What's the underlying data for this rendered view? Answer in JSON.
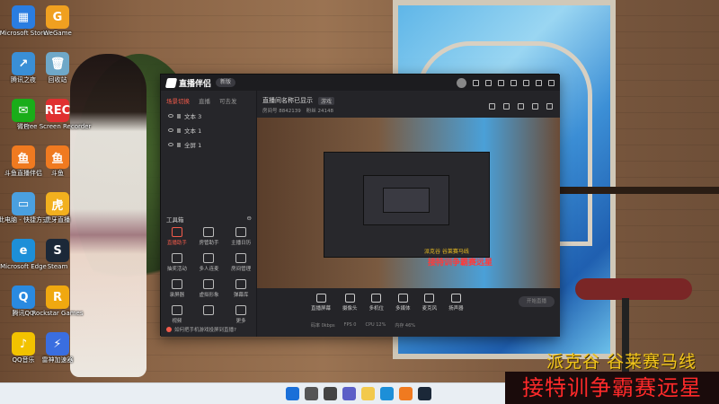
{
  "desktop": {
    "icons": [
      {
        "label": "Microsoft Store",
        "color": "#2a7de1",
        "glyph": "▦",
        "icon": "store-icon"
      },
      {
        "label": "WeGame",
        "color": "#f0a020",
        "glyph": "G",
        "icon": "wegame-icon"
      },
      {
        "label": "腾讯之夜",
        "color": "#3a8fd6",
        "glyph": "↗",
        "icon": "shortcut-icon"
      },
      {
        "label": "回收站",
        "color": "#6fa8c8",
        "glyph": "🗑",
        "icon": "recycle-bin-icon"
      },
      {
        "label": "微信",
        "color": "#1aad19",
        "glyph": "✉",
        "icon": "wechat-icon"
      },
      {
        "label": "Free Screen Recorder",
        "color": "#e03030",
        "glyph": "REC",
        "icon": "screen-recorder-icon"
      },
      {
        "label": "斗鱼直播伴侣",
        "color": "#f07a20",
        "glyph": "鱼",
        "icon": "douyu-icon"
      },
      {
        "label": "斗鱼",
        "color": "#f07a20",
        "glyph": "鱼",
        "icon": "douyu-icon"
      },
      {
        "label": "此电脑 - 快捷方式",
        "color": "#4aa0e0",
        "glyph": "▭",
        "icon": "computer-icon"
      },
      {
        "label": "虎牙直播",
        "color": "#f2b01e",
        "glyph": "虎",
        "icon": "huya-icon"
      },
      {
        "label": "Microsoft Edge",
        "color": "#1d8fd8",
        "glyph": "e",
        "icon": "edge-icon"
      },
      {
        "label": "Steam",
        "color": "#1b2838",
        "glyph": "S",
        "icon": "steam-icon"
      },
      {
        "label": "腾讯QQ",
        "color": "#2a8ae0",
        "glyph": "Q",
        "icon": "qq-icon"
      },
      {
        "label": "Rockstar Games",
        "color": "#f0a810",
        "glyph": "R",
        "icon": "rockstar-icon"
      },
      {
        "label": "QQ音乐",
        "color": "#f2c200",
        "glyph": "♪",
        "icon": "qq-music-icon"
      },
      {
        "label": "雷神加速器",
        "color": "#3a6ee0",
        "glyph": "⚡",
        "icon": "accelerator-icon"
      }
    ]
  },
  "app": {
    "name": "直播伴侣",
    "version_badge": "新版",
    "scene_tabs": [
      "场景切换",
      "直播",
      "可去发"
    ],
    "sources": [
      "文本 3",
      "文本 1",
      "全屏 1"
    ],
    "tools_title": "工具箱",
    "tools": [
      "直播助手",
      "房管助手",
      "主播日历",
      "抽奖活动",
      "多人连麦",
      "房间管理",
      "录屏器",
      "虚拟形象",
      "弹幕库",
      "视频",
      "",
      "更多"
    ],
    "bottom_note": "如何把手机游戏投屏到直播?",
    "room_title": "直播间名称已显示",
    "room_tag": "游戏",
    "room_meta": [
      "房间号 8842139",
      "粉丝 24148"
    ],
    "controls": [
      "直播屏幕",
      "摄像头",
      "多机位",
      "多媒体",
      "麦克风",
      "扬声器"
    ],
    "go_live": "开始直播",
    "stats": [
      "码率 0kbps",
      "FPS 0",
      "CPU 12%",
      "内存 46%"
    ]
  },
  "captions": {
    "yellow": "派克谷 谷莱赛马线",
    "red": "接特训争霸赛远星"
  },
  "preview_captions": {
    "yellow": "派克谷 谷莱赛马线",
    "red": "接特训争霸赛远星"
  },
  "taskbar": {
    "icons": [
      {
        "name": "windows-start-icon",
        "color": "#1a6fd8"
      },
      {
        "name": "search-icon",
        "color": "#555"
      },
      {
        "name": "task-view-icon",
        "color": "#444"
      },
      {
        "name": "chat-icon",
        "color": "#5b5fc7"
      },
      {
        "name": "file-explorer-icon",
        "color": "#f2c94c"
      },
      {
        "name": "edge-icon",
        "color": "#1d8fd8"
      },
      {
        "name": "douyu-icon",
        "color": "#f07a20"
      },
      {
        "name": "steam-icon",
        "color": "#1b2838"
      }
    ]
  }
}
